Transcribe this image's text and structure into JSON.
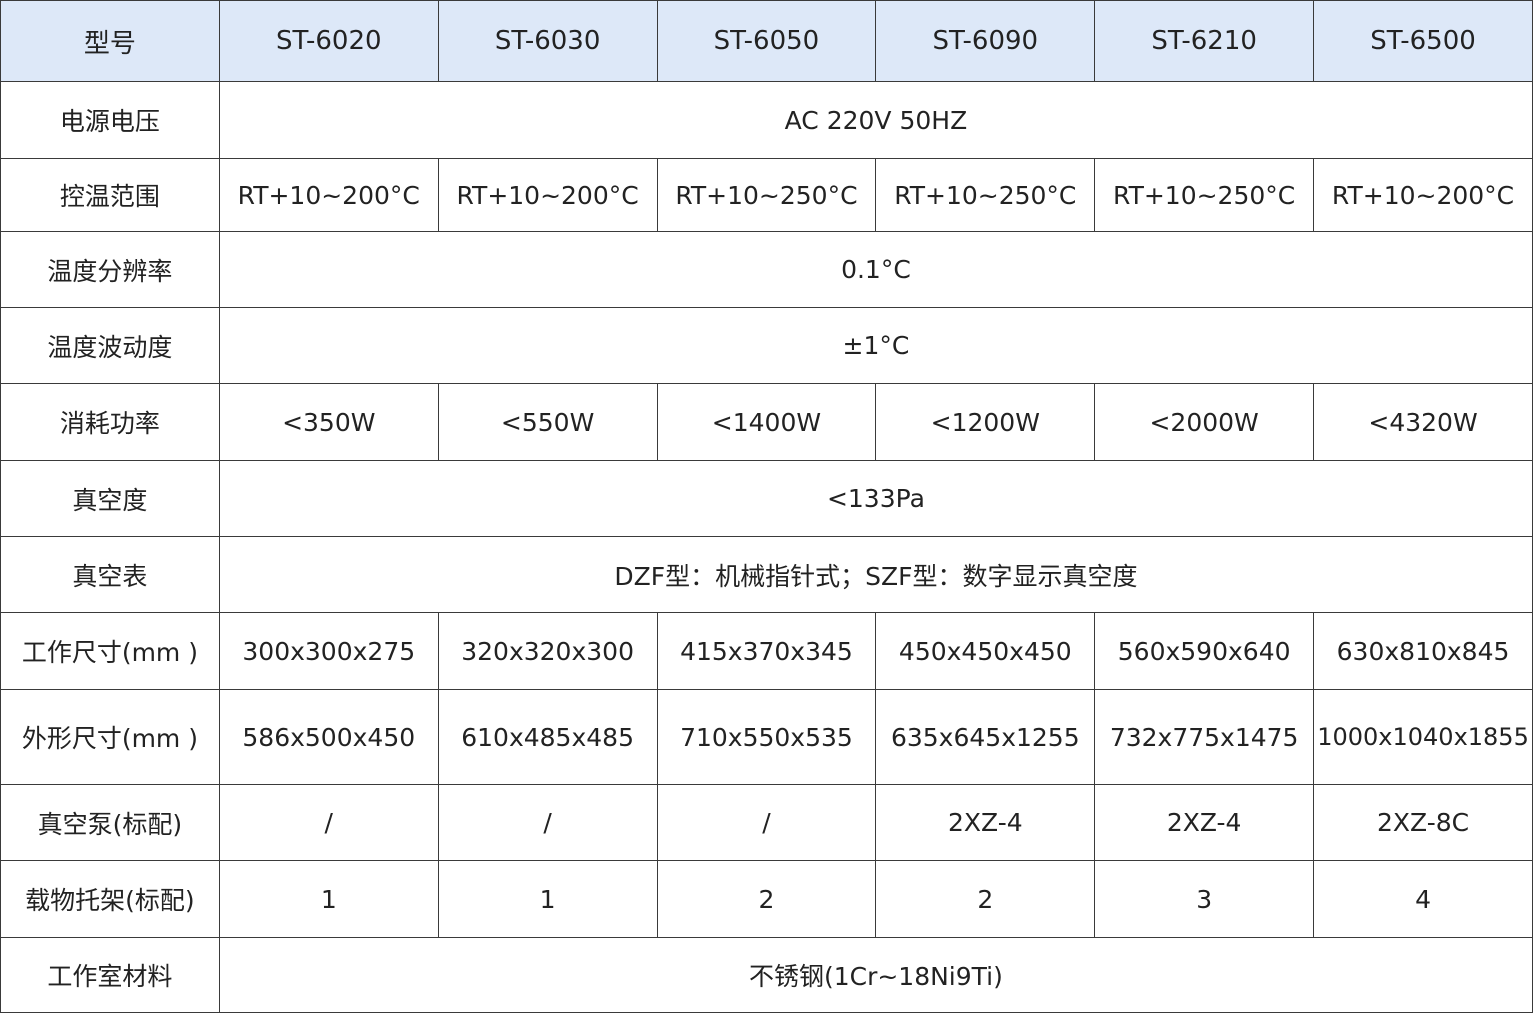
{
  "header": {
    "label": "型号",
    "models": [
      "ST-6020",
      "ST-6030",
      "ST-6050",
      "ST-6090",
      "ST-6210",
      "ST-6500"
    ]
  },
  "rows": [
    {
      "label": "电源电压",
      "merged": true,
      "value": "AC 220V 50HZ"
    },
    {
      "label": "控温范围",
      "merged": false,
      "values": [
        "RT+10~200°C",
        "RT+10~200°C",
        "RT+10~250°C",
        "RT+10~250°C",
        "RT+10~250°C",
        "RT+10~200°C"
      ]
    },
    {
      "label": "温度分辨率",
      "merged": true,
      "value": "0.1°C"
    },
    {
      "label": "温度波动度",
      "merged": true,
      "value": "±1°C"
    },
    {
      "label": "消耗功率",
      "merged": false,
      "values": [
        "<350W",
        "<550W",
        "<1400W",
        "<1200W",
        "<2000W",
        "<4320W"
      ]
    },
    {
      "label": "真空度",
      "merged": true,
      "value": "<133Pa"
    },
    {
      "label": "真空表",
      "merged": true,
      "value": "DZF型：机械指针式；SZF型：数字显示真空度"
    },
    {
      "label": "工作尺寸(mm )",
      "merged": false,
      "values": [
        "300x300x275",
        "320x320x300",
        "415x370x345",
        "450x450x450",
        "560x590x640",
        "630x810x845"
      ]
    },
    {
      "label": "外形尺寸(mm )",
      "merged": false,
      "values": [
        "586x500x450",
        "610x485x485",
        "710x550x535",
        "635x645x1255",
        "732x775x1475",
        "1000x1040x1855"
      ]
    },
    {
      "label": "真空泵(标配)",
      "merged": false,
      "values": [
        "/",
        "/",
        "/",
        "2XZ-4",
        "2XZ-4",
        "2XZ-8C"
      ]
    },
    {
      "label": "载物托架(标配)",
      "merged": false,
      "values": [
        "1",
        "1",
        "2",
        "2",
        "3",
        "4"
      ]
    },
    {
      "label": "工作室材料",
      "merged": true,
      "value": "不锈钢(1Cr~18Ni9Ti)"
    }
  ]
}
